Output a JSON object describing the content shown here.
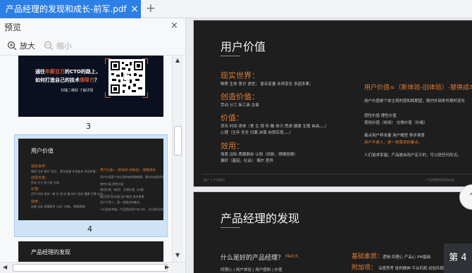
{
  "tab": {
    "title": "产品经理的发现和成长-前军.pdf",
    "close": "×",
    "add": "+"
  },
  "sidebar": {
    "title": "预览",
    "close": "×",
    "zoom_in": "放大",
    "zoom_out": "缩小",
    "thumbnails": [
      {
        "page": "3",
        "line1a": "通往",
        "line1b": "年薪百万",
        "line1c": "的CTO的路上，",
        "line2a": "如何打造自己的技术",
        "line2b": "领导力",
        "line2c": "？",
        "sub": "扫描二维码 了解详情"
      },
      {
        "page": "4",
        "title": "用户价值"
      },
      {
        "title": "产品经理的发现"
      }
    ]
  },
  "slide1": {
    "title": "用户价值",
    "sections": [
      {
        "head": "现实世界：",
        "text": "物质  生命  意识  语言；  复杂变量  永恒变化  多因多果；"
      },
      {
        "head": "创造价值：",
        "text": "劳动  分工  新工具  交易"
      },
      {
        "head": "价值：",
        "text": "货币  时间  身体（食 生 视 听 触 体力 思虑 健康 生殖 自由。。。）",
        "text2": "心理（生存  安全  归属  自尊  自我实现。。。）"
      },
      {
        "head": "效用：",
        "text": "场景  边际  质属剩余  认知（创新，想做就做）",
        "text2": "偏好（基因，社会）  偶尔  差异"
      }
    ],
    "formula": "用户价值=（新体验-旧体验）-替换成本",
    "right_texts": [
      "用户价值是个体主观的感知和期望，随内外部条件随时变化",
      "感性价值  理性价值",
      "使用价值（效用）  交换价值（价格）",
      "痛点用户样本量  用户概型  移步换景",
      "用户不是人，是一类需求的集合。",
      "人们追求幸福；产品是由用户定义的，可以提任何形式。"
    ],
    "footer_left": "梁宁 × 产品笔记",
    "footer_right": "产品经理的发现和成长"
  },
  "slide2": {
    "title": "产品经理的发现",
    "question": "什么是好的产品经理？",
    "question_tag": "Match",
    "sub1": "同理心 | 用户体验 | 用户感知 | 价值",
    "basic_label": "基础素质：",
    "basic_text": "逻辑  同理心  产品心  PM基础",
    "bonus_label": "附加项：",
    "bonus_text": "深度思考  批判精神  平台匹配  经验匹配"
  },
  "page_badge": "第 4"
}
